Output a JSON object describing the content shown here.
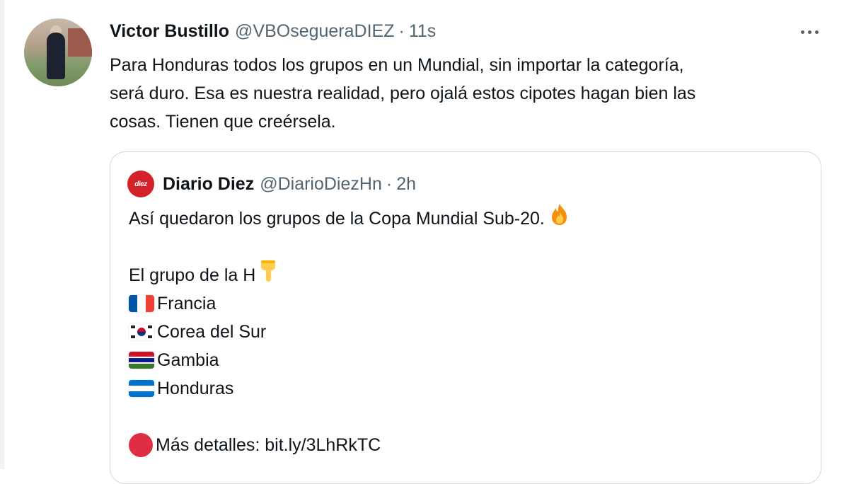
{
  "tweet": {
    "author_name": "Victor Bustillo",
    "author_handle": "@VBOsegueraDIEZ",
    "separator": "·",
    "time": "11s",
    "text": "Para Honduras todos los grupos en un Mundial, sin importar la categoría,\nserá duro. Esa es nuestra realidad, pero ojalá estos cipotes hagan bien las\ncosas. Tienen que creérsela."
  },
  "quoted": {
    "avatar_text": "diez",
    "author_name": "Diario Diez",
    "author_handle": "@DiarioDiezHn",
    "separator": "·",
    "time": "2h",
    "line1": "Así quedaron los grupos de la Copa Mundial Sub-20.",
    "line1_emoji": "🔥",
    "group_label": "El grupo de la H",
    "group_emoji": "👇",
    "teams": [
      "Francia",
      "Corea del Sur",
      "Gambia",
      "Honduras"
    ],
    "details_label": "Más detalles: bit.ly/3LhRkTC"
  },
  "colors": {
    "text": "#0f1419",
    "secondary": "#536471",
    "border": "#cfd9de",
    "brand_red": "#d22128"
  },
  "icons": {
    "more": "more-options-icon",
    "fire": "fire-emoji-icon",
    "point_down": "point-down-emoji-icon",
    "red_circle": "red-circle-emoji-icon"
  }
}
